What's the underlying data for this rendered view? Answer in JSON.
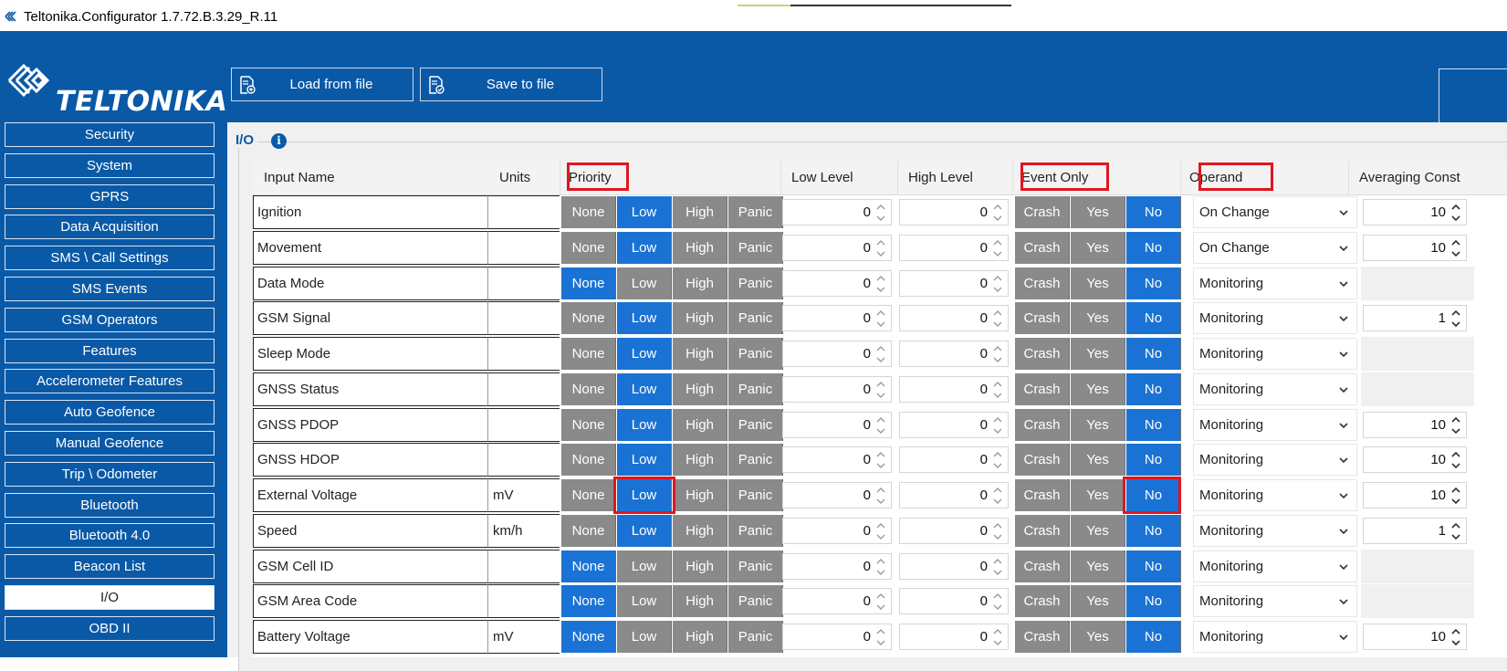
{
  "window": {
    "title": "Teltonika.Configurator 1.7.72.B.3.29_R.11"
  },
  "header": {
    "logo_text": "TELTONIKA",
    "load_label": "Load from file",
    "save_label": "Save to file"
  },
  "sidebar": {
    "items": [
      {
        "label": "Security"
      },
      {
        "label": "System"
      },
      {
        "label": "GPRS"
      },
      {
        "label": "Data Acquisition"
      },
      {
        "label": "SMS \\ Call Settings"
      },
      {
        "label": "SMS Events"
      },
      {
        "label": "GSM Operators"
      },
      {
        "label": "Features"
      },
      {
        "label": "Accelerometer Features"
      },
      {
        "label": "Auto Geofence"
      },
      {
        "label": "Manual Geofence"
      },
      {
        "label": "Trip \\ Odometer"
      },
      {
        "label": "Bluetooth"
      },
      {
        "label": "Bluetooth 4.0"
      },
      {
        "label": "Beacon List"
      },
      {
        "label": "I/O"
      },
      {
        "label": "OBD II"
      }
    ],
    "active": "I/O"
  },
  "panel": {
    "title": "I/O"
  },
  "table": {
    "headers": {
      "input_name": "Input Name",
      "units": "Units",
      "priority": "Priority",
      "low_level": "Low Level",
      "high_level": "High Level",
      "event_only": "Event Only",
      "operand": "Operand",
      "averaging": "Averaging Const"
    },
    "priority_options": [
      "None",
      "Low",
      "High",
      "Panic"
    ],
    "event_options": [
      "Crash",
      "Yes",
      "No"
    ],
    "rows": [
      {
        "name": "Ignition",
        "units": "",
        "priority": "Low",
        "low": "0",
        "high": "0",
        "event": "No",
        "operand": "On Change",
        "avg": "10"
      },
      {
        "name": "Movement",
        "units": "",
        "priority": "Low",
        "low": "0",
        "high": "0",
        "event": "No",
        "operand": "On Change",
        "avg": "10"
      },
      {
        "name": "Data Mode",
        "units": "",
        "priority": "None",
        "low": "0",
        "high": "0",
        "event": "No",
        "operand": "Monitoring",
        "avg": ""
      },
      {
        "name": "GSM Signal",
        "units": "",
        "priority": "Low",
        "low": "0",
        "high": "0",
        "event": "No",
        "operand": "Monitoring",
        "avg": "1"
      },
      {
        "name": "Sleep Mode",
        "units": "",
        "priority": "Low",
        "low": "0",
        "high": "0",
        "event": "No",
        "operand": "Monitoring",
        "avg": ""
      },
      {
        "name": "GNSS Status",
        "units": "",
        "priority": "Low",
        "low": "0",
        "high": "0",
        "event": "No",
        "operand": "Monitoring",
        "avg": ""
      },
      {
        "name": "GNSS PDOP",
        "units": "",
        "priority": "Low",
        "low": "0",
        "high": "0",
        "event": "No",
        "operand": "Monitoring",
        "avg": "10"
      },
      {
        "name": "GNSS HDOP",
        "units": "",
        "priority": "Low",
        "low": "0",
        "high": "0",
        "event": "No",
        "operand": "Monitoring",
        "avg": "10"
      },
      {
        "name": "External Voltage",
        "units": "mV",
        "priority": "Low",
        "low": "0",
        "high": "0",
        "event": "No",
        "operand": "Monitoring",
        "avg": "10"
      },
      {
        "name": "Speed",
        "units": "km/h",
        "priority": "Low",
        "low": "0",
        "high": "0",
        "event": "No",
        "operand": "Monitoring",
        "avg": "1"
      },
      {
        "name": "GSM Cell ID",
        "units": "",
        "priority": "None",
        "low": "0",
        "high": "0",
        "event": "No",
        "operand": "Monitoring",
        "avg": ""
      },
      {
        "name": "GSM Area Code",
        "units": "",
        "priority": "None",
        "low": "0",
        "high": "0",
        "event": "No",
        "operand": "Monitoring",
        "avg": ""
      },
      {
        "name": "Battery Voltage",
        "units": "mV",
        "priority": "None",
        "low": "0",
        "high": "0",
        "event": "No",
        "operand": "Monitoring",
        "avg": "10"
      }
    ]
  },
  "colors": {
    "brand_blue": "#0a59a7",
    "selected_blue": "#1a73d4",
    "unselected_gray": "#8a8a8a",
    "highlight_red": "#e0161f"
  }
}
